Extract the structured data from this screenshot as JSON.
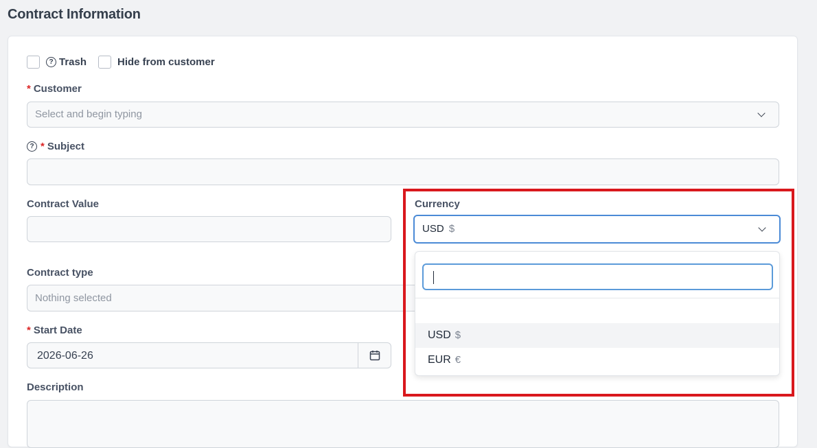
{
  "page": {
    "title": "Contract Information"
  },
  "flags": {
    "trash_label": "Trash",
    "hide_label": "Hide from customer"
  },
  "customer": {
    "label": "Customer",
    "required_mark": "*",
    "placeholder": "Select and begin typing"
  },
  "subject": {
    "label": "Subject",
    "required_mark": "*",
    "value": ""
  },
  "contract_value": {
    "label": "Contract Value",
    "value": ""
  },
  "currency": {
    "label": "Currency",
    "selected_code": "USD",
    "selected_symbol": "$",
    "search_value": "",
    "options": [
      {
        "code": "USD",
        "symbol": "$"
      },
      {
        "code": "EUR",
        "symbol": "€"
      }
    ]
  },
  "contract_type": {
    "label": "Contract type",
    "placeholder": "Nothing selected"
  },
  "start_date": {
    "label": "Start Date",
    "required_mark": "*",
    "value": "2026-06-26"
  },
  "description": {
    "label": "Description",
    "value": ""
  },
  "colors": {
    "accent": "#3b82f6",
    "required": "#dc2626",
    "highlight": "#d9181d"
  }
}
